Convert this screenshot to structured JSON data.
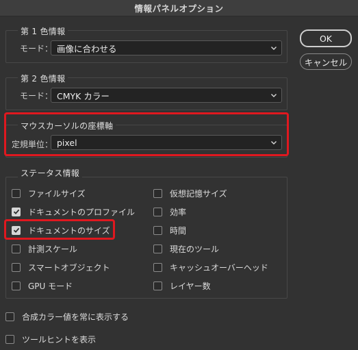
{
  "window": {
    "title": "情報パネルオプション"
  },
  "first_color": {
    "title": "第 1 色情報",
    "mode_label": "モード：",
    "mode_value": "画像に合わせる"
  },
  "second_color": {
    "title": "第 2 色情報",
    "mode_label": "モード：",
    "mode_value": "CMYK カラー"
  },
  "mouse_coords": {
    "title": "マウスカーソルの座標軸",
    "unit_label": "定規単位：",
    "unit_value": "pixel"
  },
  "status": {
    "title": "ステータス情報",
    "left": [
      {
        "label": "ファイルサイズ",
        "checked": false
      },
      {
        "label": "ドキュメントのプロファイル",
        "checked": true
      },
      {
        "label": "ドキュメントのサイズ",
        "checked": true
      },
      {
        "label": "計測スケール",
        "checked": false
      },
      {
        "label": "スマートオブジェクト",
        "checked": false
      },
      {
        "label": "GPU モード",
        "checked": false
      }
    ],
    "right": [
      {
        "label": "仮想記憶サイズ",
        "checked": false
      },
      {
        "label": "効率",
        "checked": false
      },
      {
        "label": "時間",
        "checked": false
      },
      {
        "label": "現在のツール",
        "checked": false
      },
      {
        "label": "キャッシュオーバーヘッド",
        "checked": false
      },
      {
        "label": "レイヤー数",
        "checked": false
      }
    ]
  },
  "bottom_options": [
    {
      "label": "合成カラー値を常に表示する",
      "checked": false
    },
    {
      "label": "ツールヒントを表示",
      "checked": false
    }
  ],
  "buttons": {
    "ok": "OK",
    "cancel": "キャンセル"
  },
  "colors": {
    "highlight": "#e0181f",
    "background": "#323232"
  },
  "icons": {
    "select_arrow": "chevron-down-icon",
    "check": "checkmark-icon"
  }
}
